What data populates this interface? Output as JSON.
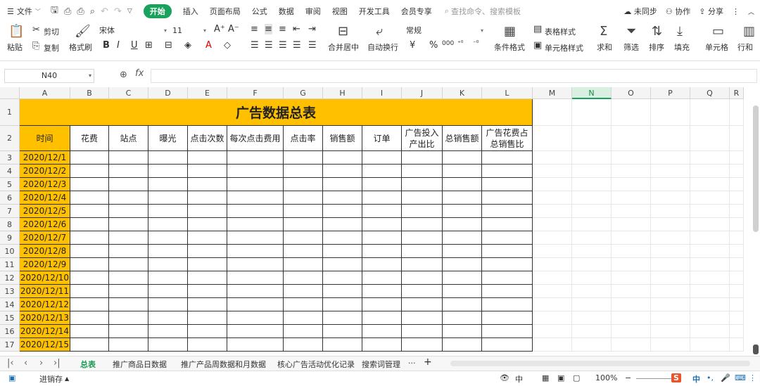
{
  "menubar": {
    "file_label": "文件",
    "tabs": [
      "开始",
      "插入",
      "页面布局",
      "公式",
      "数据",
      "审阅",
      "视图",
      "开发工具",
      "会员专享"
    ],
    "active_tab": "开始",
    "search_placeholder": "查找命令、搜索模板",
    "sync_label": "未同步",
    "collab_label": "协作",
    "share_label": "分享"
  },
  "ribbon": {
    "paste": "粘贴",
    "cut": "剪切",
    "copy": "复制",
    "format_painter": "格式刷",
    "font_name": "宋体",
    "font_size": "11",
    "merge_center": "合并居中",
    "wrap_text": "自动换行",
    "number_format": "常规",
    "table_style": "表格样式",
    "cond_format": "条件格式",
    "cell_style": "单元格样式",
    "sum": "求和",
    "filter": "筛选",
    "sort": "排序",
    "fill": "填充",
    "cell": "单元格",
    "rowcol": "行和"
  },
  "formula": {
    "name_box": "N40",
    "fx_label": "fx",
    "value": ""
  },
  "grid": {
    "columns": [
      "A",
      "B",
      "C",
      "D",
      "E",
      "F",
      "G",
      "H",
      "I",
      "J",
      "K",
      "L",
      "M",
      "N",
      "O",
      "P",
      "Q",
      "R"
    ],
    "active_column": "N",
    "rows": [
      "1",
      "2",
      "3",
      "4",
      "5",
      "6",
      "7",
      "8",
      "9",
      "10",
      "11",
      "12",
      "13",
      "14",
      "15",
      "16",
      "17"
    ],
    "title": "广告数据总表",
    "headers": [
      "时间",
      "花费",
      "站点",
      "曝光",
      "点击次数",
      "每次点击费用",
      "点击率",
      "销售额",
      "订单",
      "广告投入产出比",
      "总销售额",
      "广告花费占总销售比"
    ],
    "dates": [
      "2020/12/1",
      "2020/12/2",
      "2020/12/3",
      "2020/12/4",
      "2020/12/5",
      "2020/12/6",
      "2020/12/7",
      "2020/12/8",
      "2020/12/9",
      "2020/12/10",
      "2020/12/11",
      "2020/12/12",
      "2020/12/13",
      "2020/12/14",
      "2020/12/15"
    ]
  },
  "sheets": {
    "tabs": [
      "总表",
      "推广商品日数据",
      "推广产品周数据和月数据",
      "核心广告活动优化记录",
      "搜索词管理"
    ],
    "active": "总表",
    "more": "···",
    "add": "+"
  },
  "status": {
    "save_label": "进销存",
    "zoom": "100%",
    "ime_label": "中"
  },
  "colors": {
    "accent": "#1aa15b",
    "title_fill": "#ffc000",
    "date_fill": "#ffc000"
  }
}
